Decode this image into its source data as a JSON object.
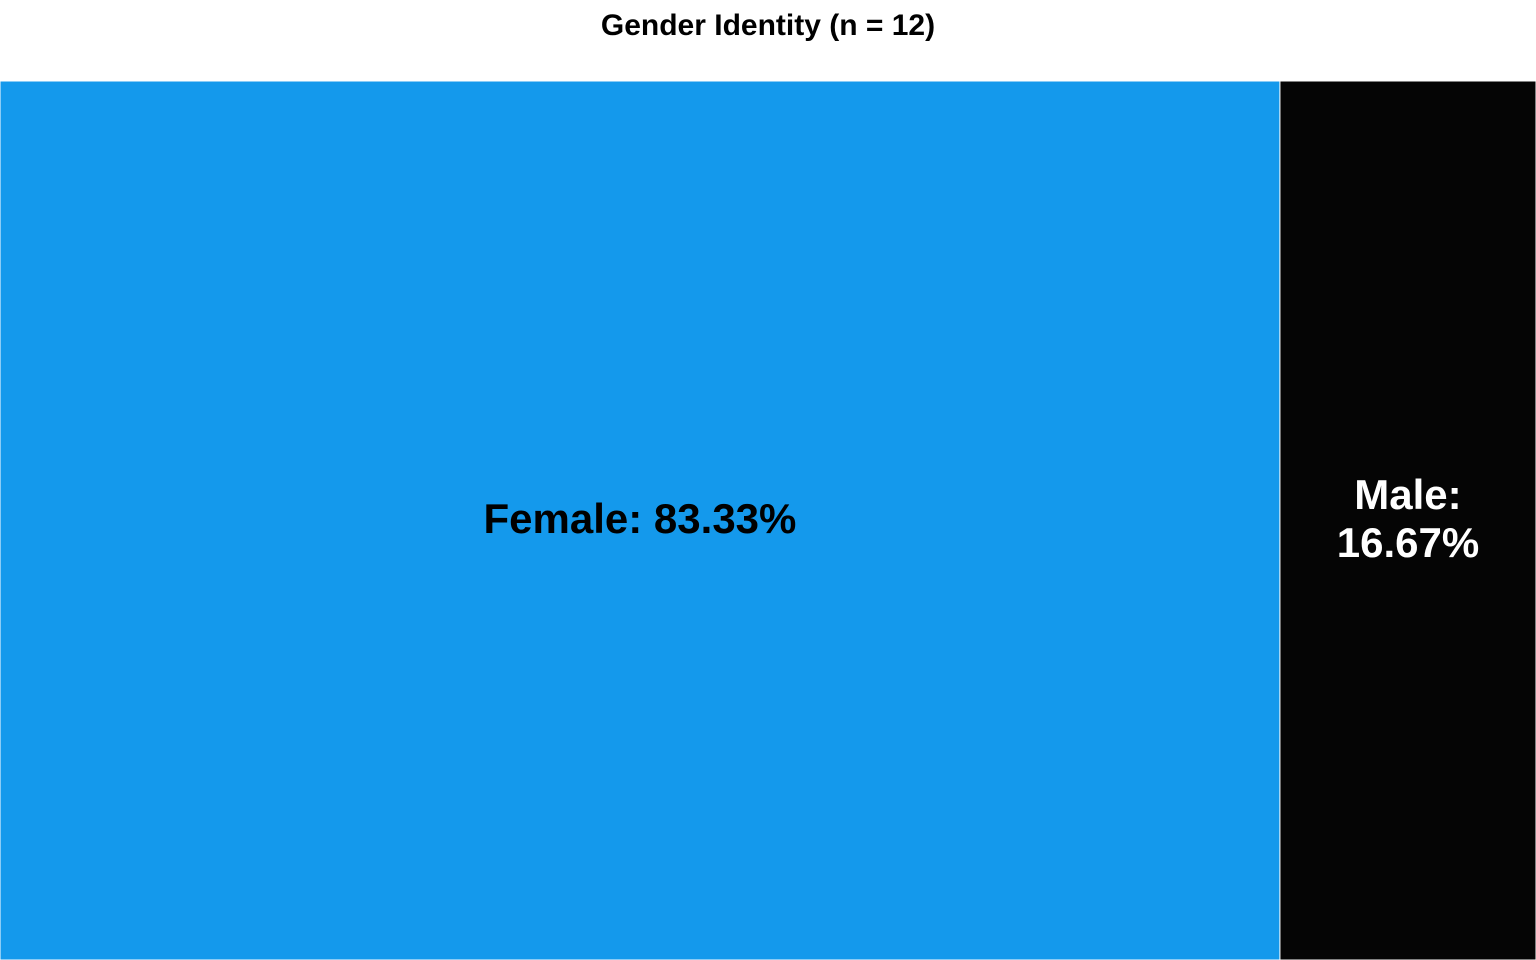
{
  "chart_data": {
    "type": "treemap",
    "title": "Gender Identity (n = 12)",
    "total_n": 12,
    "items": [
      {
        "name": "Female",
        "value": 83.33,
        "label": "Female: 83.33%",
        "label_lines": [
          "Female: 83.33%"
        ],
        "color": "#1499ec",
        "text_color": "#000000"
      },
      {
        "name": "Male",
        "value": 16.67,
        "label": "Male: 16.67%",
        "label_lines": [
          "Male:",
          "16.67%"
        ],
        "color": "#050505",
        "text_color": "#ffffff"
      }
    ],
    "unit": "%"
  }
}
